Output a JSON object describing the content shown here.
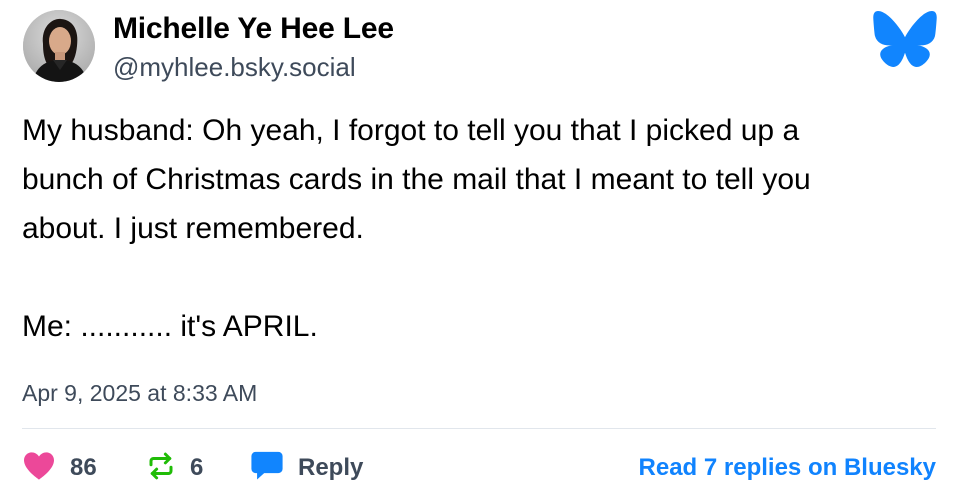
{
  "author": {
    "name": "Michelle Ye Hee Lee",
    "handle": "@myhlee.bsky.social"
  },
  "post": {
    "text": "My husband: Oh yeah, I forgot to tell you that I picked up a\nbunch of Christmas cards in the mail that I meant to tell you\nabout. I just remembered.\n\nMe: ........... it's APRIL.",
    "timestamp": "Apr 9, 2025 at 8:33 AM"
  },
  "actions": {
    "likes": "86",
    "reposts": "6",
    "reply_label": "Reply",
    "read_replies_label": "Read 7 replies on Bluesky"
  },
  "icons": {
    "brand": "bluesky-butterfly-icon",
    "like": "heart-icon",
    "repost": "repost-icon",
    "reply": "speech-bubble-icon"
  },
  "colors": {
    "brand_blue": "#1185fe",
    "like_pink": "#ec4899",
    "repost_green": "#20bc07",
    "link_blue": "#1083fe",
    "muted_text": "#3e4a5a"
  }
}
